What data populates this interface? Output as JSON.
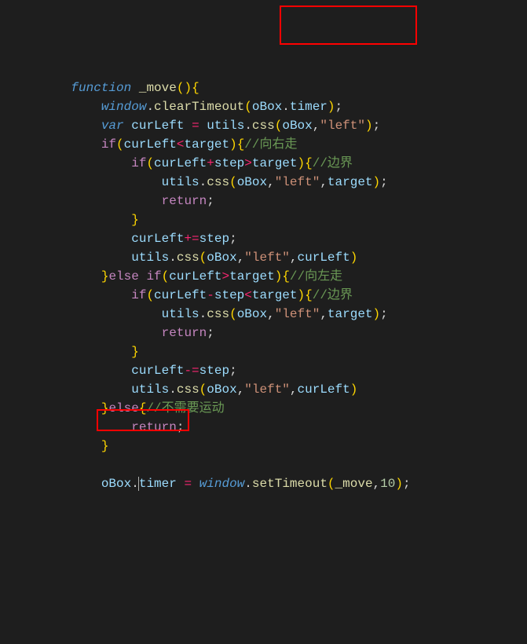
{
  "code": {
    "t_function": "function",
    "t_var": "var",
    "t_window": "window",
    "t_return": "return",
    "t_if": "if",
    "t_else": "else",
    "fn_move": "_move",
    "fn_clearTimeout": "clearTimeout",
    "fn_css": "css",
    "fn_setTimeout": "setTimeout",
    "id_curLeft": "curLeft",
    "id_target": "target",
    "id_step": "step",
    "id_utils": "utils",
    "id_oBox": "oBox",
    "id_timer": "timer",
    "str_left": "\"left\"",
    "num_10": "10",
    "c_right": "//向右走",
    "c_bound": "//边界",
    "c_left": "//向左走",
    "c_nomove": "//不需要运动"
  },
  "highlights": {
    "box1_target": "(oBox.timer);",
    "box2_target": "oBox.|timer"
  }
}
